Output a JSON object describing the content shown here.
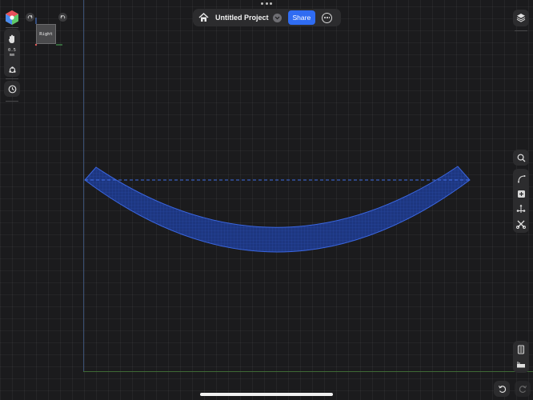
{
  "toolbar": {
    "project_title": "Untitled Project",
    "share_label": "Share"
  },
  "left_panel": {
    "thickness_value": "0.5",
    "thickness_unit": "mm"
  },
  "viewcube": {
    "face_label": "Right"
  },
  "icons": {
    "home": "home-icon",
    "dropdown": "chevron-down-icon",
    "more": "ellipsis-circle-icon",
    "layers": "layers-icon",
    "search": "magnifier-icon",
    "undo": "undo-icon",
    "redo": "redo-icon"
  },
  "colors": {
    "share_button": "#2f6cf2",
    "shape_fill": "#1e3a86",
    "shape_stroke": "#3a66e0",
    "axis_vertical": "#3a4f73",
    "axis_horizontal": "#3f6a35"
  }
}
